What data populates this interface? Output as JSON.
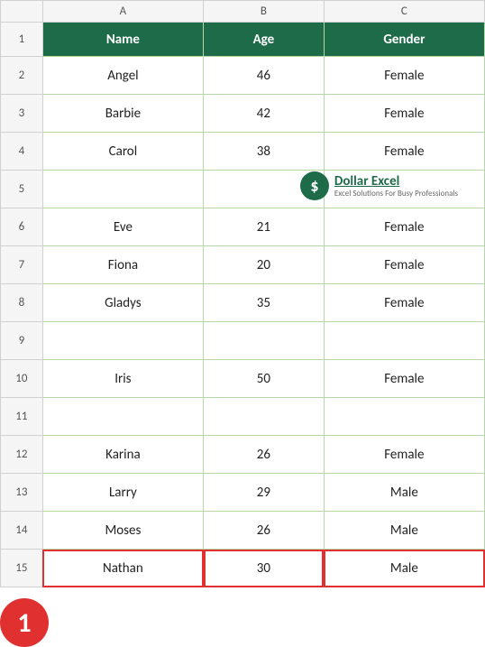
{
  "columns": {
    "row_header": "",
    "a": "A",
    "b": "B",
    "c": "C"
  },
  "header_row": {
    "row_num": "1",
    "name": "Name",
    "age": "Age",
    "gender": "Gender"
  },
  "rows": [
    {
      "row_num": "2",
      "name": "Angel",
      "age": "46",
      "gender": "Female"
    },
    {
      "row_num": "3",
      "name": "Barbie",
      "age": "42",
      "gender": "Female"
    },
    {
      "row_num": "4",
      "name": "Carol",
      "age": "38",
      "gender": "Female"
    },
    {
      "row_num": "5",
      "name": "",
      "age": "",
      "gender": ""
    },
    {
      "row_num": "6",
      "name": "Eve",
      "age": "21",
      "gender": "Female"
    },
    {
      "row_num": "7",
      "name": "Fiona",
      "age": "20",
      "gender": "Female"
    },
    {
      "row_num": "8",
      "name": "Gladys",
      "age": "35",
      "gender": "Female"
    },
    {
      "row_num": "9",
      "name": "",
      "age": "",
      "gender": ""
    },
    {
      "row_num": "10",
      "name": "Iris",
      "age": "50",
      "gender": "Female"
    },
    {
      "row_num": "11",
      "name": "",
      "age": "",
      "gender": ""
    },
    {
      "row_num": "12",
      "name": "Karina",
      "age": "26",
      "gender": "Female"
    },
    {
      "row_num": "13",
      "name": "Larry",
      "age": "29",
      "gender": "Male"
    },
    {
      "row_num": "14",
      "name": "Moses",
      "age": "26",
      "gender": "Male"
    },
    {
      "row_num": "15",
      "name": "Nathan",
      "age": "30",
      "gender": "Male",
      "selected": true
    }
  ],
  "logo": {
    "icon": "$",
    "main_text": "Dollar Excel",
    "sub_text": "Excel Solutions For Busy Professionals"
  },
  "badge": {
    "label": "1"
  }
}
